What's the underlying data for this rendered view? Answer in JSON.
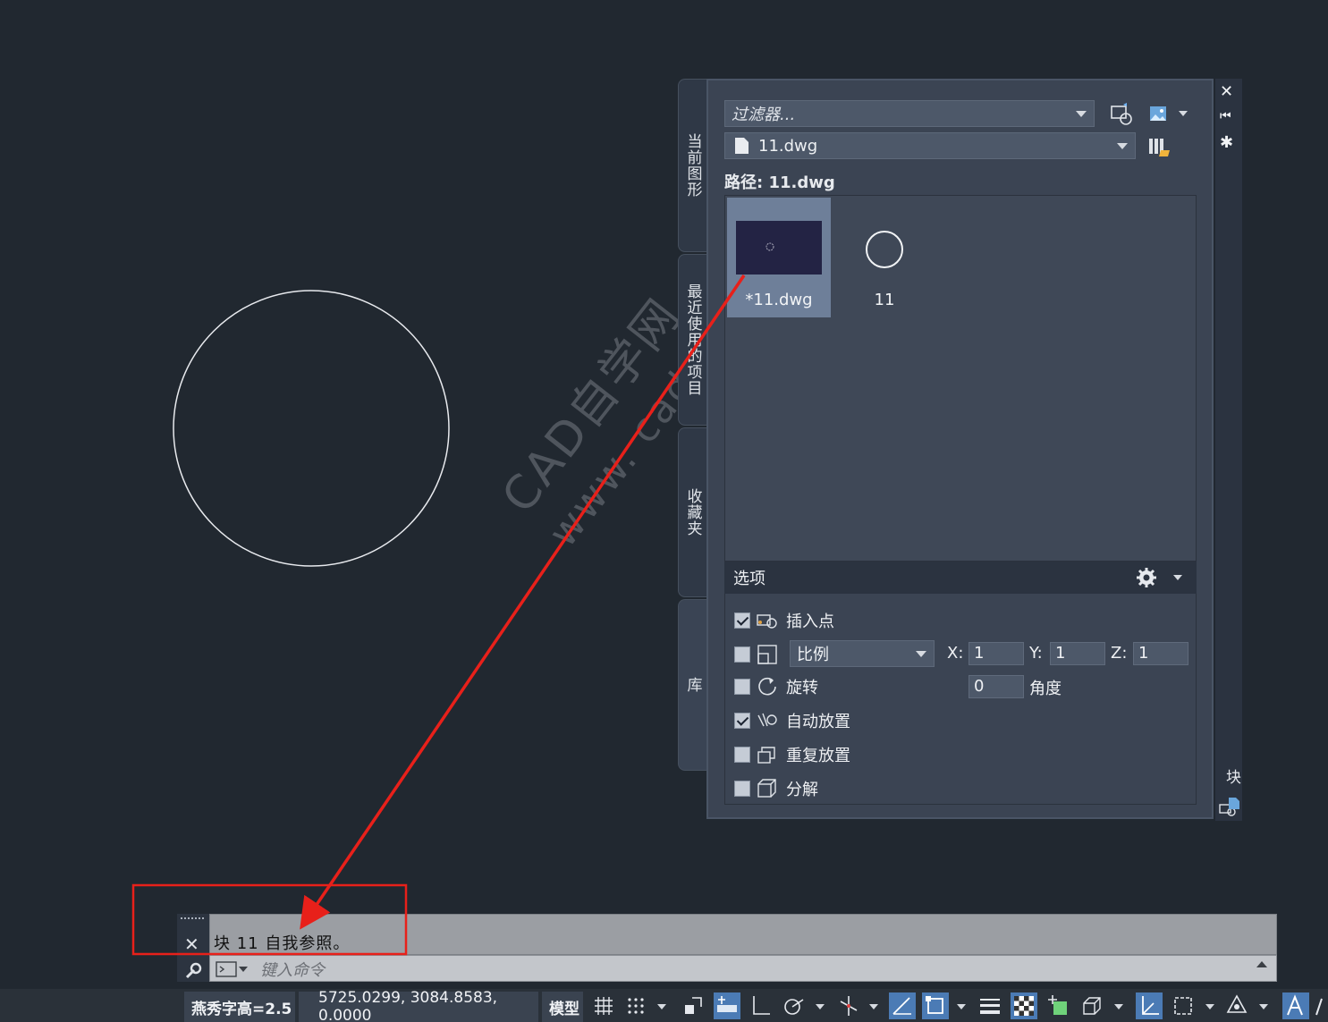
{
  "palette": {
    "tabs": [
      "当前图形",
      "最近使用的项目",
      "收藏夹",
      "库"
    ],
    "filter_placeholder": "过滤器...",
    "file_combo": "11.dwg",
    "path_label": "路径: 11.dwg",
    "items": [
      {
        "label": "*11.dwg",
        "selected": true
      },
      {
        "label": "11",
        "selected": false
      }
    ],
    "side_title": "块",
    "controls": {
      "close": "✕",
      "collapse": "⏮",
      "settings": "✱"
    }
  },
  "options": {
    "title": "选项",
    "insert_point": {
      "label": "插入点",
      "checked": true
    },
    "scale": {
      "checked": false,
      "mode": "比例",
      "x_label": "X:",
      "x": "1",
      "y_label": "Y:",
      "y": "1",
      "z_label": "Z:",
      "z": "1"
    },
    "rotation": {
      "label": "旋转",
      "checked": false,
      "value": "0",
      "unit": "角度"
    },
    "auto_place": {
      "label": "自动放置",
      "checked": true
    },
    "repeat_place": {
      "label": "重复放置",
      "checked": false
    },
    "explode": {
      "label": "分解",
      "checked": false
    }
  },
  "command": {
    "history": "块  11  自我参照。",
    "input_placeholder": "键入命令"
  },
  "status": {
    "text_height": "燕秀字高=2.5",
    "coordinates": "5725.0299, 3084.8583, 0.0000",
    "space": "模型"
  },
  "watermark": {
    "line1": "CAD自学网",
    "line2": "www. cadzxw. com"
  },
  "colors": {
    "canvas": "#212830",
    "accent": "#4b7bb5",
    "annotation": "#e8201a"
  }
}
